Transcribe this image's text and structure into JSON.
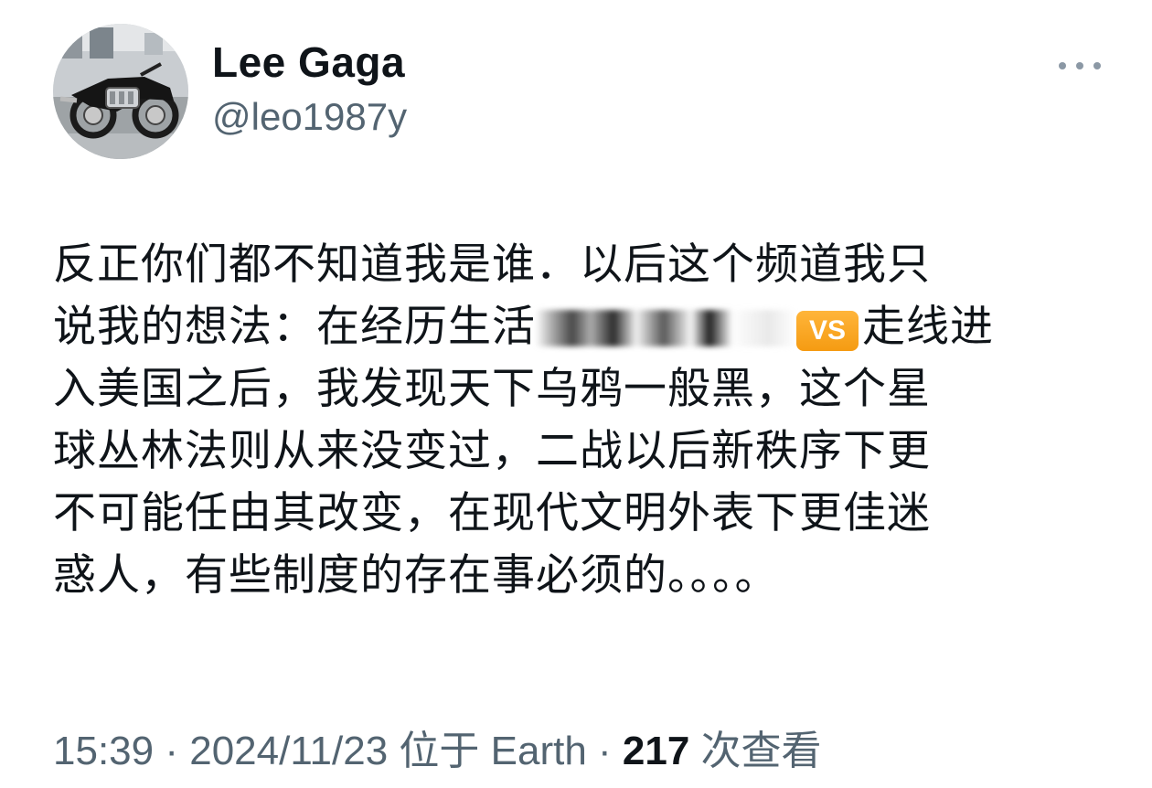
{
  "author": {
    "display_name": "Lee Gaga",
    "handle": "@leo1987y",
    "avatar_icon": "motorcycle-avatar"
  },
  "tweet": {
    "line_1": "反正你们都不知道我是谁．以后这个频道我只",
    "line_2_before_redaction": "说我的想法：在经历生活",
    "line_2_badge": "VS",
    "line_2_after_badge": "走线进",
    "line_3": "入美国之后，我发现天下乌鸦一般黑，这个星",
    "line_4": "球丛林法则从来没变过，二战以后新秩序下更",
    "line_5": "不可能任由其改变，在现代文明外表下更佳迷",
    "line_6": "惑人，有些制度的存在事必须的。。。。"
  },
  "meta": {
    "time": "15:39",
    "separator_1": " · ",
    "date": "2024/11/23",
    "location": " 位于 Earth",
    "separator_2": " · ",
    "views_count": "217",
    "views_label": " 次查看"
  },
  "colors": {
    "text_primary": "#0f1419",
    "text_secondary": "#536471",
    "badge_orange": "#f59b12"
  }
}
